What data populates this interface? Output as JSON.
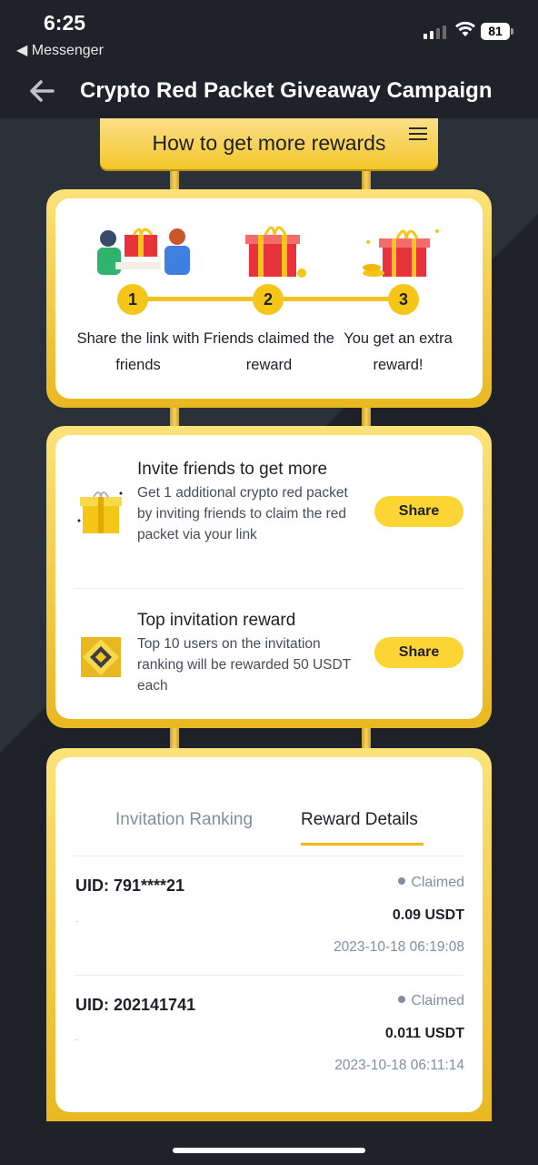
{
  "status_bar": {
    "time": "6:25",
    "back_app": "◀ Messenger",
    "battery": "81"
  },
  "nav": {
    "title": "Crypto Red Packet Giveaway Campaign"
  },
  "header": {
    "title": "How to get more rewards"
  },
  "steps": [
    {
      "number": "1",
      "text": "Share the link with friends"
    },
    {
      "number": "2",
      "text": "Friends claimed the reward"
    },
    {
      "number": "3",
      "text": "You get an extra reward!"
    }
  ],
  "invite": {
    "title": "Invite friends to get more",
    "description": "Get 1 additional crypto red packet by inviting friends to claim the red packet via your link",
    "button": "Share"
  },
  "top_reward": {
    "title": "Top invitation reward",
    "description": "Top 10 users on the invitation ranking will be rewarded 50 USDT each",
    "button": "Share"
  },
  "tabs": {
    "ranking": "Invitation Ranking",
    "details": "Reward Details",
    "active": "details"
  },
  "rewards": [
    {
      "uid": "UID: 791****21",
      "status": "Claimed",
      "amount": "0.09 USDT",
      "date": "2023-10-18 06:19:08"
    },
    {
      "uid": "UID: 202141741",
      "status": "Claimed",
      "amount": "0.011 USDT",
      "date": "2023-10-18 06:11:14"
    }
  ],
  "colors": {
    "brand_yellow": "#fcd535",
    "accent": "#f0b90b",
    "dark_bg": "#1f2329"
  }
}
